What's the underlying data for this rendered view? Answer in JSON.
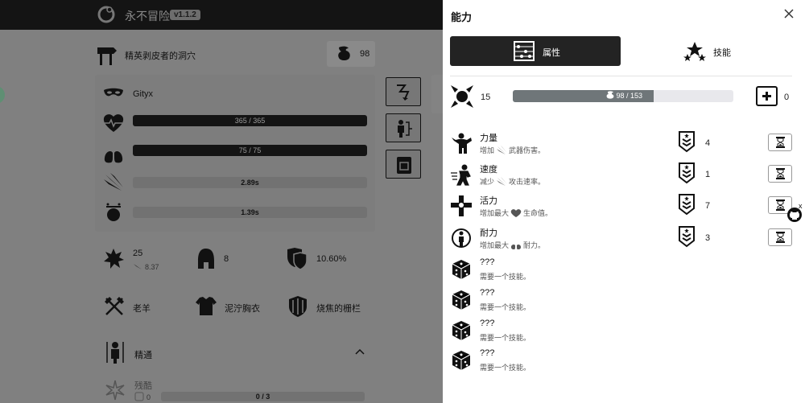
{
  "app": {
    "title": "永不冒险",
    "version": "v1.1.2"
  },
  "location": {
    "name": "精英剥皮者的洞穴",
    "gold": "98"
  },
  "character": {
    "name": "Gityx",
    "health": "365 / 365",
    "stamina": "75 / 75",
    "attack_rate": "2.89s",
    "stun": "1.39s"
  },
  "stats": {
    "damage": "25",
    "damage_sub": "8.37",
    "protection": "8",
    "deflection": "10.60%"
  },
  "equipment": {
    "weapon": "老羊",
    "armor": "泥泞胸衣",
    "shield": "烧焦的栅栏"
  },
  "mastery": {
    "title": "精通",
    "skill": "残酷",
    "skill_points": "0",
    "progress": "0 / 3"
  },
  "drawer": {
    "title": "能力",
    "tabs": [
      {
        "label": "属性",
        "active": true
      },
      {
        "label": "技能",
        "active": false
      }
    ],
    "points": "15",
    "xp_text": "98 / 153",
    "xp_fraction": 0.64,
    "plus_count": "0",
    "attributes": [
      {
        "name": "力量",
        "pre": "增加",
        "post": "武器伤害。",
        "level": "4"
      },
      {
        "name": "速度",
        "pre": "减少",
        "post": "攻击速率。",
        "level": "1"
      },
      {
        "name": "活力",
        "pre": "增加最大",
        "post": "生命值。",
        "level": "7"
      },
      {
        "name": "耐力",
        "pre": "增加最大",
        "post": "耐力。",
        "level": "3"
      }
    ],
    "locked": [
      {
        "name": "???",
        "desc": "需要一个技能。"
      },
      {
        "name": "???",
        "desc": "需要一个技能。"
      },
      {
        "name": "???",
        "desc": "需要一个技能。"
      },
      {
        "name": "???",
        "desc": "需要一个技能。"
      }
    ],
    "github_close": "x"
  }
}
